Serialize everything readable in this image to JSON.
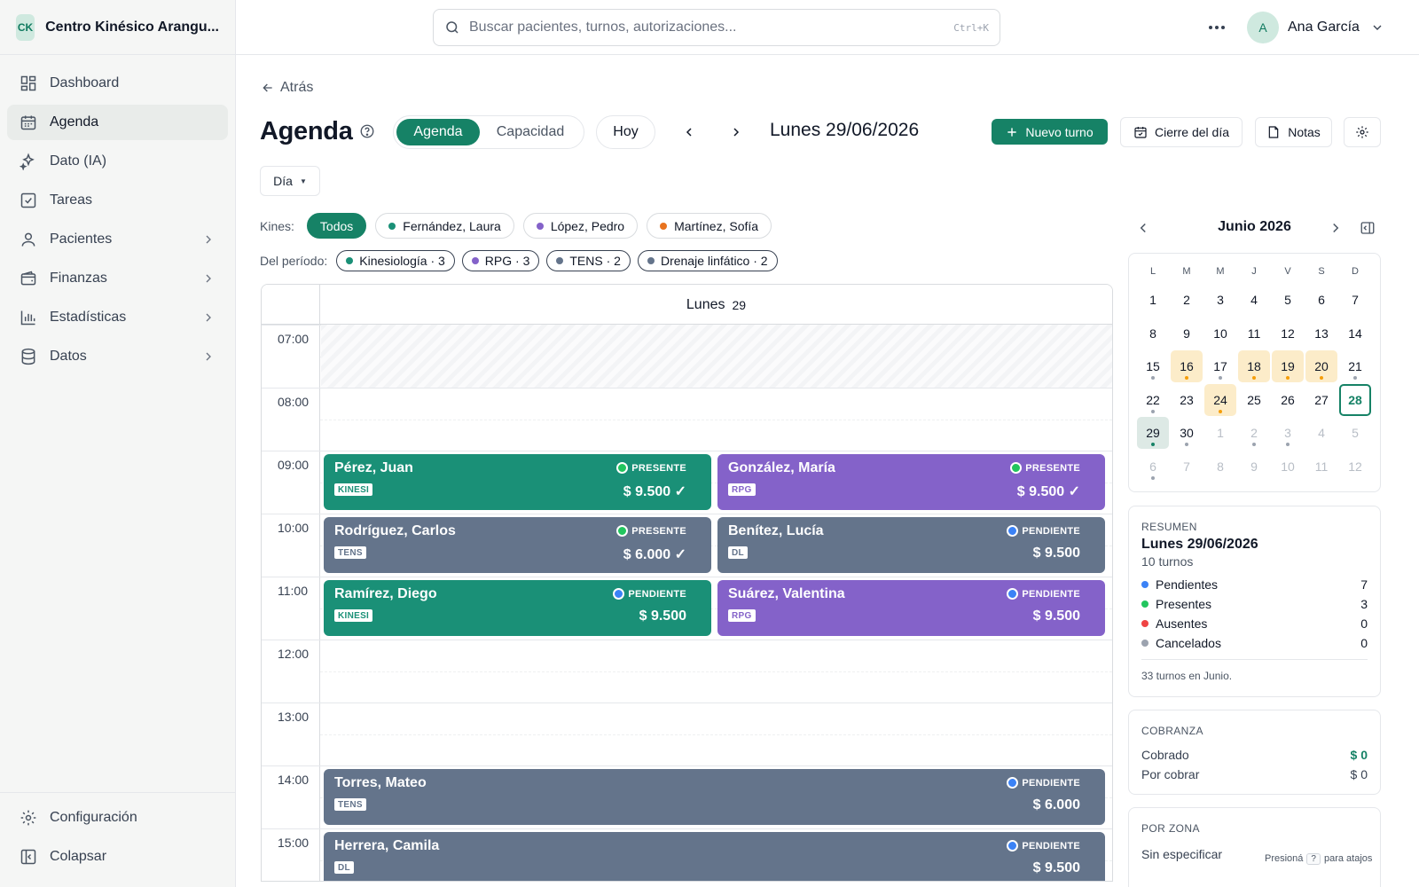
{
  "brand": {
    "logo": "CK",
    "name": "Centro Kinésico Arangu..."
  },
  "sidebar": {
    "items": [
      {
        "label": "Dashboard",
        "icon": "dashboard-icon",
        "active": false
      },
      {
        "label": "Agenda",
        "icon": "calendar-icon",
        "active": true
      },
      {
        "label": "Dato (IA)",
        "icon": "sparkles-icon",
        "active": false
      },
      {
        "label": "Tareas",
        "icon": "checkbox-icon",
        "active": false
      },
      {
        "label": "Pacientes",
        "icon": "user-icon",
        "active": false,
        "expandable": true
      },
      {
        "label": "Finanzas",
        "icon": "wallet-icon",
        "active": false,
        "expandable": true
      },
      {
        "label": "Estadísticas",
        "icon": "bar-chart-icon",
        "active": false,
        "expandable": true
      },
      {
        "label": "Datos",
        "icon": "database-icon",
        "active": false,
        "expandable": true
      }
    ],
    "bottom": [
      {
        "label": "Configuración",
        "icon": "gear-icon"
      },
      {
        "label": "Colapsar",
        "icon": "collapse-sidebar-icon"
      }
    ]
  },
  "topbar": {
    "search_placeholder": "Buscar pacientes, turnos, autorizaciones...",
    "search_shortcut": "Ctrl+K",
    "user": {
      "initial": "A",
      "name": "Ana García"
    }
  },
  "header": {
    "back_label": "Atrás",
    "title": "Agenda",
    "tabs": [
      "Agenda",
      "Capacidad"
    ],
    "today_label": "Hoy",
    "current_date": "Lunes 29/06/2026",
    "new_appointment_label": "Nuevo turno",
    "close_day_label": "Cierre del día",
    "notes_label": "Notas",
    "view_select": "Día"
  },
  "filters": {
    "kines_label": "Kines:",
    "kines": [
      {
        "label": "Todos",
        "active": true,
        "color": ""
      },
      {
        "label": "Fernández, Laura",
        "active": false,
        "color": "#1a9077"
      },
      {
        "label": "López, Pedro",
        "active": false,
        "color": "#8462c9"
      },
      {
        "label": "Martínez, Sofía",
        "active": false,
        "color": "#e8731f"
      }
    ],
    "period_label": "Del período:",
    "period": [
      {
        "label": "Kinesiología · 3",
        "color": "#1a9077"
      },
      {
        "label": "RPG · 3",
        "color": "#8462c9"
      },
      {
        "label": "TENS · 2",
        "color": "#64748b"
      },
      {
        "label": "Drenaje linfático · 2",
        "color": "#64748b"
      }
    ]
  },
  "day_view": {
    "day_name": "Lunes",
    "day_number": "29",
    "hours": [
      "07:00",
      "08:00",
      "09:00",
      "10:00",
      "11:00",
      "12:00",
      "13:00",
      "14:00",
      "15:00"
    ],
    "appointments": [
      {
        "patient": "Pérez, Juan",
        "tag": "KINESI",
        "status": "PRESENTE",
        "price": "$ 9.500 ✓",
        "theme": "green",
        "hour": "09:00",
        "column": 1,
        "span": 1
      },
      {
        "patient": "González, María",
        "tag": "RPG",
        "status": "PRESENTE",
        "price": "$ 9.500 ✓",
        "theme": "purple",
        "hour": "09:00",
        "column": 2,
        "span": 1
      },
      {
        "patient": "Rodríguez, Carlos",
        "tag": "TENS",
        "status": "PRESENTE",
        "price": "$ 6.000 ✓",
        "theme": "slate",
        "hour": "10:00",
        "column": 1,
        "span": 1
      },
      {
        "patient": "Benítez, Lucía",
        "tag": "DL",
        "status": "PENDIENTE",
        "price": "$ 9.500",
        "theme": "slate",
        "hour": "10:00",
        "column": 2,
        "span": 1
      },
      {
        "patient": "Ramírez, Diego",
        "tag": "KINESI",
        "status": "PENDIENTE",
        "price": "$ 9.500",
        "theme": "green",
        "hour": "11:00",
        "column": 1,
        "span": 1
      },
      {
        "patient": "Suárez, Valentina",
        "tag": "RPG",
        "status": "PENDIENTE",
        "price": "$ 9.500",
        "theme": "purple",
        "hour": "11:00",
        "column": 2,
        "span": 1
      },
      {
        "patient": "Torres, Mateo",
        "tag": "TENS",
        "status": "PENDIENTE",
        "price": "$ 6.000",
        "theme": "slate",
        "hour": "14:00",
        "column": 1,
        "span": 2
      },
      {
        "patient": "Herrera, Camila",
        "tag": "DL",
        "status": "PENDIENTE",
        "price": "$ 9.500",
        "theme": "slate",
        "hour": "15:00",
        "column": 1,
        "span": 2
      }
    ],
    "status_colors": {
      "PRESENTE": "#22c55e",
      "PENDIENTE": "#3b82f6"
    }
  },
  "mini_calendar": {
    "title": "Junio 2026",
    "weekdays": [
      "L",
      "M",
      "M",
      "J",
      "V",
      "S",
      "D"
    ],
    "weeks": [
      [
        {
          "d": "1"
        },
        {
          "d": "2"
        },
        {
          "d": "3"
        },
        {
          "d": "4"
        },
        {
          "d": "5"
        },
        {
          "d": "6"
        },
        {
          "d": "7"
        }
      ],
      [
        {
          "d": "8"
        },
        {
          "d": "9"
        },
        {
          "d": "10"
        },
        {
          "d": "11"
        },
        {
          "d": "12"
        },
        {
          "d": "13"
        },
        {
          "d": "14"
        }
      ],
      [
        {
          "d": "15",
          "dot": "gray"
        },
        {
          "d": "16",
          "hi": true,
          "dot": "orange"
        },
        {
          "d": "17",
          "dot": "gray"
        },
        {
          "d": "18",
          "hi": true,
          "dot": "orange"
        },
        {
          "d": "19",
          "hi": true,
          "dot": "orange"
        },
        {
          "d": "20",
          "hi": true,
          "dot": "orange"
        },
        {
          "d": "21",
          "dot": "gray"
        }
      ],
      [
        {
          "d": "22",
          "dot": "gray"
        },
        {
          "d": "23"
        },
        {
          "d": "24",
          "hi": true,
          "dot": "orange"
        },
        {
          "d": "25"
        },
        {
          "d": "26"
        },
        {
          "d": "27"
        },
        {
          "d": "28",
          "today": true
        }
      ],
      [
        {
          "d": "29",
          "sel": true,
          "dot": "green"
        },
        {
          "d": "30",
          "dot": "gray"
        },
        {
          "d": "1",
          "mut": true
        },
        {
          "d": "2",
          "mut": true,
          "dot": "gray"
        },
        {
          "d": "3",
          "mut": true,
          "dot": "gray"
        },
        {
          "d": "4",
          "mut": true
        },
        {
          "d": "5",
          "mut": true
        }
      ],
      [
        {
          "d": "6",
          "mut": true,
          "dot": "gray"
        },
        {
          "d": "7",
          "mut": true
        },
        {
          "d": "8",
          "mut": true
        },
        {
          "d": "9",
          "mut": true
        },
        {
          "d": "10",
          "mut": true
        },
        {
          "d": "11",
          "mut": true
        },
        {
          "d": "12",
          "mut": true
        }
      ]
    ],
    "dot_colors": {
      "gray": "#9ca3af",
      "orange": "#f59e0b",
      "green": "#168266"
    }
  },
  "summary": {
    "title": "RESUMEN",
    "date": "Lunes 29/06/2026",
    "count": "10 turnos",
    "rows": [
      {
        "label": "Pendientes",
        "value": "7",
        "color": "#3b82f6"
      },
      {
        "label": "Presentes",
        "value": "3",
        "color": "#22c55e"
      },
      {
        "label": "Ausentes",
        "value": "0",
        "color": "#ef4444"
      },
      {
        "label": "Cancelados",
        "value": "0",
        "color": "#9ca3af"
      }
    ],
    "footer": "33 turnos en Junio."
  },
  "cobranza": {
    "title": "COBRANZA",
    "rows": [
      {
        "label": "Cobrado",
        "value": "$ 0",
        "color": "#168266"
      },
      {
        "label": "Por cobrar",
        "value": "$ 0",
        "color": "#111827"
      }
    ]
  },
  "por_zona": {
    "title": "POR ZONA",
    "value": "Sin especificar"
  },
  "shortcut_hint": {
    "before": "Presioná",
    "key": "?",
    "after": "para atajos"
  },
  "colors": {
    "accent": "#168266"
  }
}
